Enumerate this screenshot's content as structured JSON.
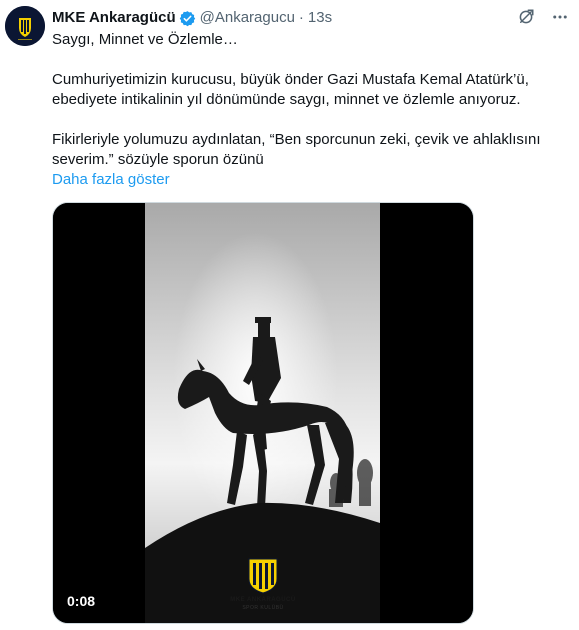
{
  "tweet": {
    "author_name": "MKE Ankaragücü",
    "handle": "@Ankaragucu",
    "separator": "·",
    "time": "13s",
    "paragraphs": [
      "Saygı, Minnet ve Özlemle…",
      "Cumhuriyetimizin kurucusu, büyük önder Gazi Mustafa Kemal Atatürk’ü, ebediyete intikalinin yıl dönümünde saygı, minnet ve özlemle anıyoruz.",
      "Fikirleriyle yolumuzu aydınlatan, “Ben sporcunun zeki, çevik ve ahlaklısını severim.” sözüyle sporun özünü"
    ],
    "show_more": "Daha fazla göster"
  },
  "media": {
    "duration": "0:08",
    "club_logo_text": "MKE ANKARAGÜCÜ",
    "club_sub_text": "SPOR KULÜBÜ"
  },
  "icons": {
    "verified": "verified-badge-icon",
    "grok": "grok-icon",
    "more": "more-icon"
  },
  "colors": {
    "link": "#1d9bf0",
    "verified": "#1d9bf0",
    "muted": "#536471",
    "club_yellow": "#f5d000",
    "club_navy": "#0b1633"
  }
}
